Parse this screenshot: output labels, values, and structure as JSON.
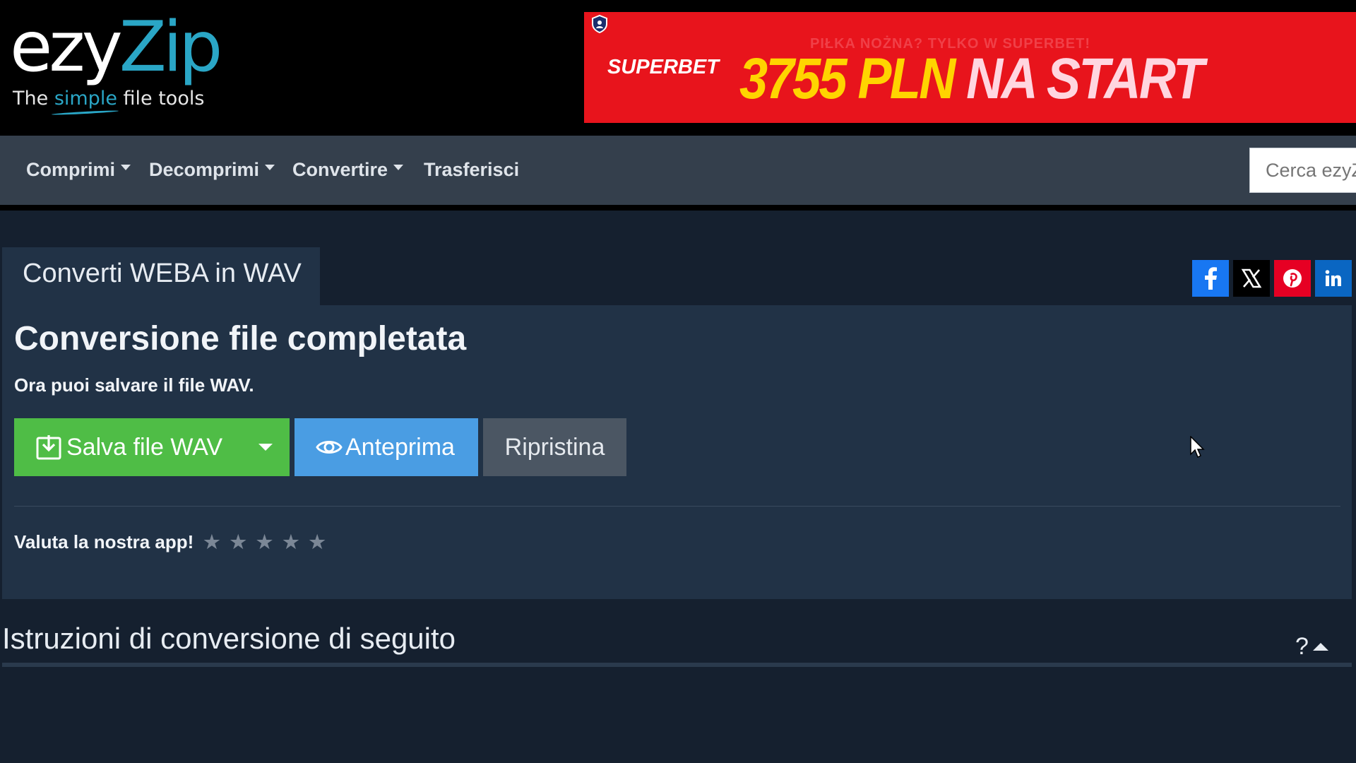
{
  "logo": {
    "part1": "ezy",
    "part2": "Zip",
    "tagline_pre": "The ",
    "tagline_simple": "simple",
    "tagline_post": " file tools"
  },
  "ad": {
    "ghost_text": "PIŁKA NOŻNA? TYLKO W SUPERBET!",
    "brand": "SUPERBET",
    "headline_a": "3755 PLN ",
    "headline_b": "NA START",
    "badge_icon": "shield-icon"
  },
  "nav": {
    "items": [
      {
        "label": "Comprimi",
        "dropdown": true
      },
      {
        "label": "Decomprimi",
        "dropdown": true
      },
      {
        "label": "Convertire",
        "dropdown": true
      },
      {
        "label": "Trasferisci",
        "dropdown": false
      }
    ],
    "search_placeholder": "Cerca ezyZip"
  },
  "tab": {
    "label": "Converti WEBA in WAV"
  },
  "share": [
    {
      "icon": "facebook-icon",
      "color": "#1877f2"
    },
    {
      "icon": "x-twitter-icon",
      "color": "#000000"
    },
    {
      "icon": "pinterest-icon",
      "color": "#e60023"
    },
    {
      "icon": "linkedin-icon",
      "color": "#0a66c2"
    }
  ],
  "panel": {
    "title": "Conversione file completata",
    "subtitle": "Ora puoi salvare il file WAV.",
    "buttons": {
      "save": "Salva file WAV",
      "preview": "Anteprima",
      "reset": "Ripristina"
    },
    "rating_label": "Valuta la nostra app!",
    "rating_stars": [
      "★",
      "★",
      "★",
      "★",
      "★"
    ],
    "rating_value": 0
  },
  "section": {
    "title": "Istruzioni di conversione di seguito",
    "help": "?"
  },
  "colors": {
    "accent_blue": "#2aa6c6",
    "save_green": "#4fbd46",
    "preview_blue": "#4a9de3",
    "panel_bg": "#213246"
  }
}
